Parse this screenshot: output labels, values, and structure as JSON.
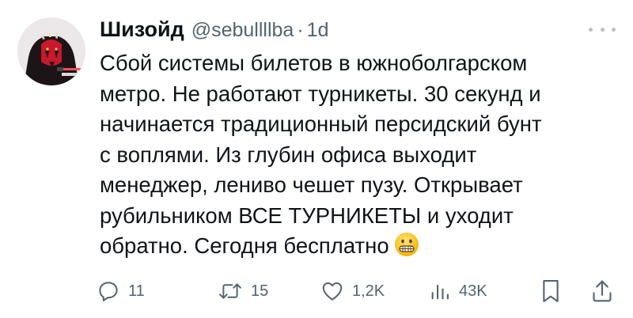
{
  "tweet": {
    "author": {
      "display_name": "Шизойд",
      "handle": "@sebullllba",
      "separator": "·",
      "time": "1d",
      "avatar_icon": "sith-lord-avatar-icon"
    },
    "text_lines": [
      "Сбой системы билетов в южноболгарском",
      "метро. Не работают турникеты. 30 секунд и",
      "начинается традиционный персидский бунт",
      "с воплями. Из глубин офиса выходит",
      "менеджер, лениво чешет пузу. Открывает",
      "рубильником ВСЕ ТУРНИКЕТЫ и уходит",
      "обратно. Сегодня бесплатно"
    ],
    "trailing_emoji": "grimacing-face-icon",
    "actions": {
      "replies": "11",
      "retweets": "15",
      "likes": "1,2K",
      "views": "43K"
    },
    "colors": {
      "text": "#0f1419",
      "secondary": "#536471",
      "avatar_red": "#c9182b"
    }
  }
}
